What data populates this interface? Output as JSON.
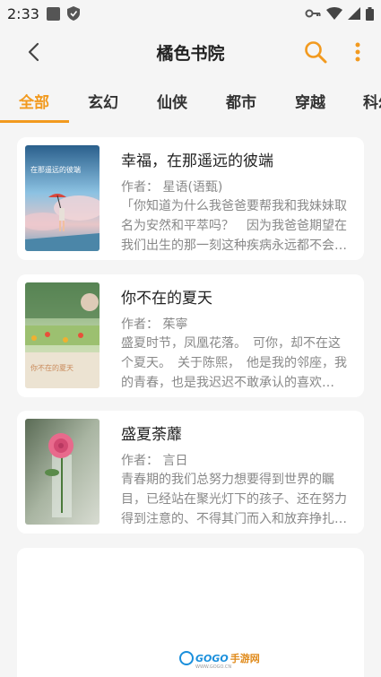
{
  "status_bar": {
    "time": "2:33"
  },
  "app_bar": {
    "title": "橘色书院"
  },
  "tabs": [
    {
      "label": "全部",
      "active": true
    },
    {
      "label": "玄幻",
      "active": false
    },
    {
      "label": "仙侠",
      "active": false
    },
    {
      "label": "都市",
      "active": false
    },
    {
      "label": "穿越",
      "active": false
    },
    {
      "label": "科幻",
      "active": false
    }
  ],
  "books": [
    {
      "title": "幸福，在那遥远的彼端",
      "author": "作者：  星语(语甄)",
      "description": "「你知道为什么我爸爸要帮我和我妹妹取名为安然和平萃吗？　因为我爸爸期望在我们出生的那一刻这种疾病永远都不会…",
      "cover_text": "在那遥远的彼端"
    },
    {
      "title": "你不在的夏天",
      "author": "作者：  茱寧",
      "description": "盛夏时节，凤凰花落。　可你，却不在这个夏天。　关于陈熙，　他是我的邻座，我的青春，也是我迟迟不敢承认的喜欢…",
      "cover_text": "你不在的夏天"
    },
    {
      "title": "盛夏荼蘼",
      "author": "作者：  言日",
      "description": "青春期的我们总努力想要得到世界的瞩目，已经站在聚光灯下的孩子、还在努力得到注意的、不得其门而入和放弃挣扎…",
      "cover_text": ""
    }
  ],
  "watermark": {
    "brand": "GOGO",
    "brand_cn": "手游网",
    "url": "WWW.GOGO.CN"
  },
  "colors": {
    "accent": "#f29a1f",
    "background": "#f5f5f5"
  }
}
